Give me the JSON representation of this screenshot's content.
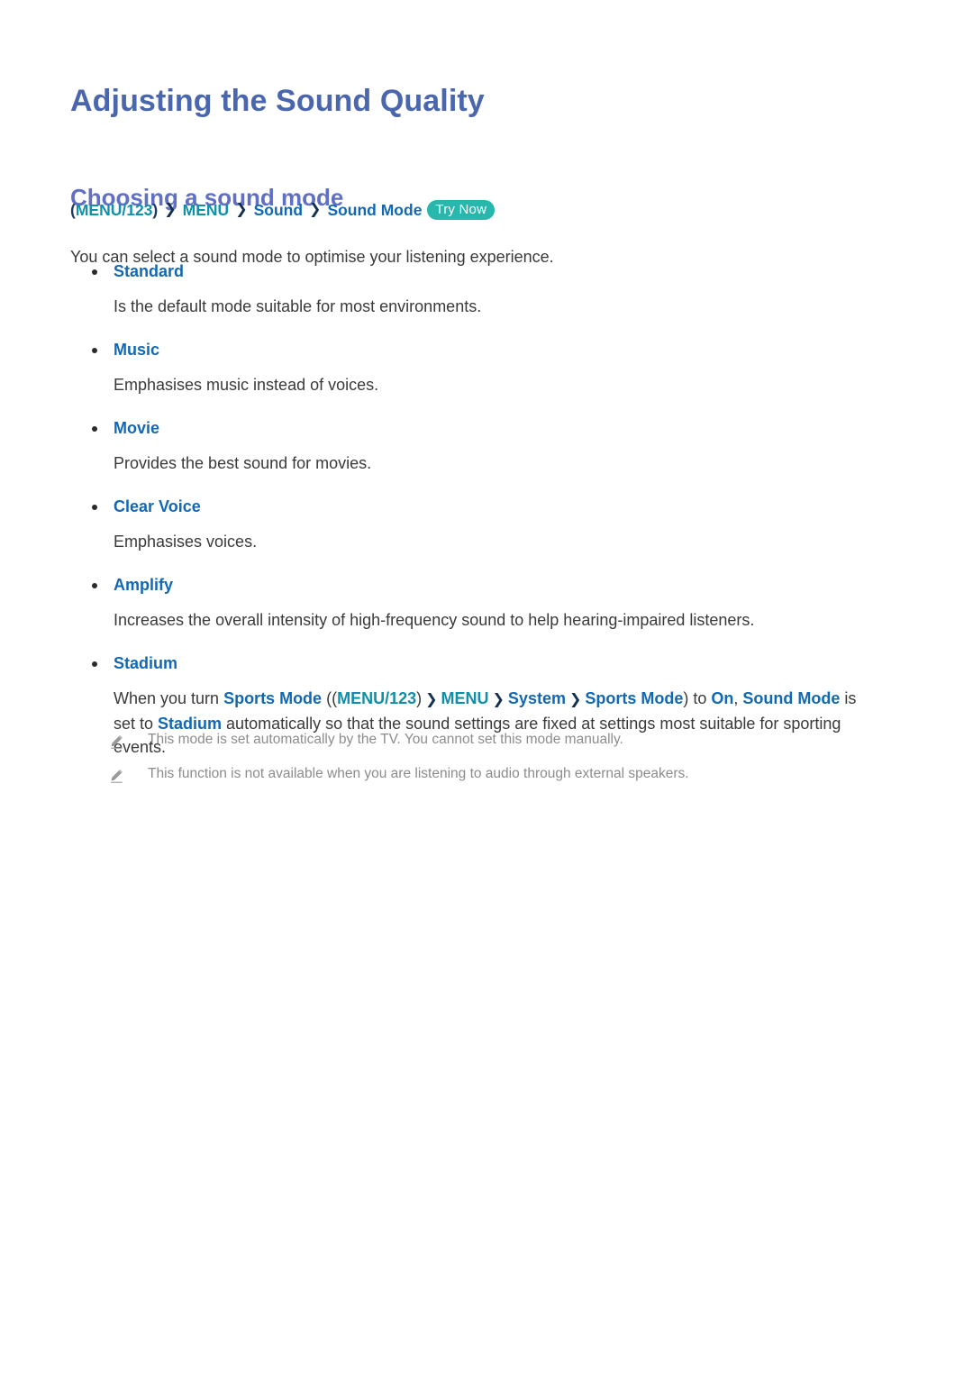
{
  "document": {
    "title": "Adjusting the Sound Quality",
    "section_heading": "Choosing a sound mode",
    "intro": "You can select a sound mode to optimise your listening experience."
  },
  "colors": {
    "title": "#4a66ad",
    "section_heading": "#6270c4",
    "link_blue": "#1268b3",
    "link_teal": "#0f8fa8",
    "separator": "#14304f",
    "body_text": "#3a3a3a",
    "note_text": "#8c8c8c",
    "try_now_pill": "#27b7ac",
    "page_background": "#ffffff"
  },
  "breadcrumb": {
    "open_paren": "(",
    "menu123": "MENU/123",
    "close_paren": ")",
    "separator": "❯",
    "menu": "MENU",
    "sound": "Sound",
    "sound_mode": "Sound Mode",
    "try_now_label": "Try Now"
  },
  "modes": [
    {
      "term": "Standard",
      "description": "Is the default mode suitable for most environments."
    },
    {
      "term": "Music",
      "description": "Emphasises music instead of voices."
    },
    {
      "term": "Movie",
      "description": "Provides the best sound for movies."
    },
    {
      "term": "Clear Voice",
      "description": "Emphasises voices."
    },
    {
      "term": "Amplify",
      "description": "Increases the overall intensity of high-frequency sound to help hearing-impaired listeners."
    },
    {
      "term": "Stadium",
      "description_parts": {
        "p1": "When you turn ",
        "sports_mode_1": "Sports Mode",
        "p2": " ((",
        "menu123": "MENU/123",
        "p3": ")",
        "sep1": "❯",
        "menu": "MENU",
        "sep2": "❯",
        "system": "System",
        "sep3": "❯",
        "sports_mode_2": "Sports Mode",
        "p4": ") to ",
        "on": "On",
        "p5": ", ",
        "sound_mode": "Sound Mode",
        "p6": " is set to ",
        "stadium": "Stadium",
        "p7": " automatically so that the sound settings are fixed at settings most suitable for sporting events."
      }
    }
  ],
  "notes": [
    {
      "icon": "pencil-icon",
      "text": "This mode is set automatically by the TV. You cannot set this mode manually."
    },
    {
      "icon": "pencil-icon",
      "text": "This function is not available when you are listening to audio through external speakers."
    }
  ]
}
